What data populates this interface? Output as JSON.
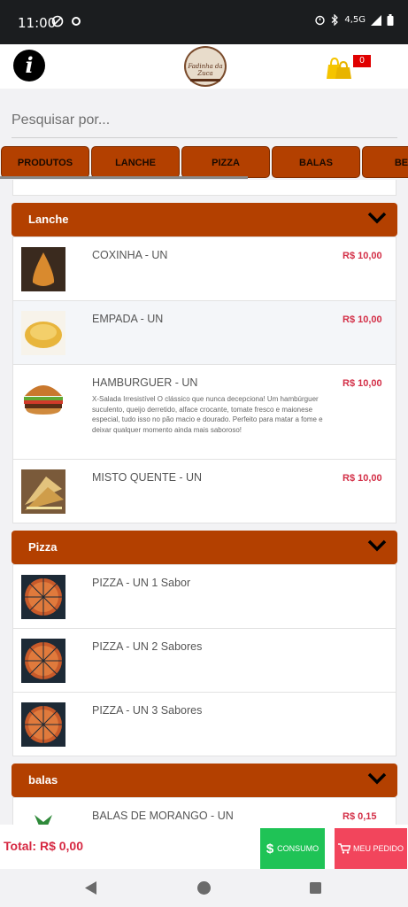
{
  "status_bar": {
    "time": "11:00",
    "network": "4,5G"
  },
  "top_bar": {
    "logo_text": "Fadinha da Zuca",
    "cart_count": "0"
  },
  "search": {
    "placeholder": "Pesquisar por..."
  },
  "tabs": [
    "PRODUTOS",
    "LANCHE",
    "PIZZA",
    "BALAS",
    "BEBI"
  ],
  "sections": {
    "lanche": {
      "title": "Lanche",
      "items": [
        {
          "name": "COXINHA - UN",
          "price": "R$ 10,00",
          "desc": ""
        },
        {
          "name": "EMPADA - UN",
          "price": "R$ 10,00",
          "desc": ""
        },
        {
          "name": "HAMBURGUER - UN",
          "price": "R$ 10,00",
          "desc": "X-Salada Irresistível O clássico que nunca decepciona! Um hambúrguer suculento, queijo derretido, alface crocante, tomate fresco e maionese especial, tudo isso no pão macio e dourado. Perfeito para matar a fome e deixar qualquer momento ainda mais saboroso!"
        },
        {
          "name": "MISTO QUENTE - UN",
          "price": "R$ 10,00",
          "desc": ""
        }
      ]
    },
    "pizza": {
      "title": "Pizza",
      "items": [
        {
          "name": "PIZZA - UN 1 Sabor"
        },
        {
          "name": "PIZZA - UN 2 Sabores"
        },
        {
          "name": "PIZZA - UN 3 Sabores"
        }
      ]
    },
    "balas": {
      "title": "balas",
      "items": [
        {
          "name": "BALAS DE MORANGO - UN",
          "price": "R$ 0,15"
        }
      ]
    }
  },
  "footer": {
    "total": "Total: R$ 0,00",
    "consumo_label": "CONSUMO",
    "pedido_label": "MEU PEDIDO"
  },
  "colors": {
    "accent": "#b34000",
    "price": "#d32f47",
    "consumo": "#1fc356",
    "pedido": "#f2455c"
  }
}
